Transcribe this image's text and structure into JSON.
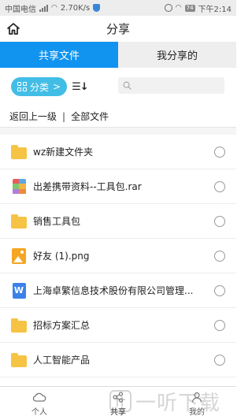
{
  "status_bar": {
    "carrier": "中国电信",
    "network_speed": "2.70K/s",
    "battery": "74",
    "time": "下午2:14"
  },
  "header": {
    "title": "分享",
    "home_icon": "home-icon"
  },
  "tabs": [
    {
      "label": "共享文件",
      "active": true
    },
    {
      "label": "我分享的",
      "active": false
    }
  ],
  "filter": {
    "category_label": "分类",
    "category_arrow": ">",
    "sort_glyph": "☰↓",
    "search_placeholder": ""
  },
  "breadcrumb": {
    "back_label": "返回上一级",
    "separator": "|",
    "all_files_label": "全部文件"
  },
  "files": [
    {
      "name": "wz新建文件夹",
      "type": "folder"
    },
    {
      "name": "出差携带资料--工具包.rar",
      "type": "rar"
    },
    {
      "name": "销售工具包",
      "type": "folder"
    },
    {
      "name": "好友 (1).png",
      "type": "image"
    },
    {
      "name": "上海卓繁信息技术股份有限公司管理...",
      "type": "word"
    },
    {
      "name": "招标方案汇总",
      "type": "folder"
    },
    {
      "name": "人工智能产品",
      "type": "folder"
    }
  ],
  "bottom_nav": [
    {
      "label": "个人",
      "icon": "cloud-icon",
      "active": false
    },
    {
      "label": "共享",
      "icon": "share-icon",
      "active": true
    },
    {
      "label": "我的",
      "icon": "user-icon",
      "active": false
    }
  ],
  "watermark": {
    "text": "一听下载"
  },
  "colors": {
    "accent_blue": "#1193f0",
    "category_pill": "#42bde6",
    "folder_yellow": "#f6c344"
  }
}
